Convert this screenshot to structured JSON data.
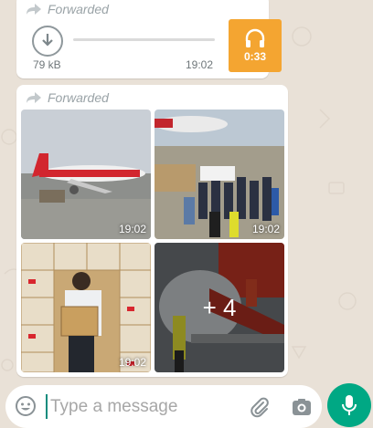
{
  "audio_message": {
    "forwarded_label": "Forwarded",
    "file_size": "79 kB",
    "time": "19:02",
    "duration": "0:33",
    "thumb_color": "#f4a531",
    "icons": [
      "download-icon",
      "headphones-icon",
      "forward-arrow-icon"
    ]
  },
  "album_message": {
    "forwarded_label": "Forwarded",
    "photos": [
      {
        "time": "19:02"
      },
      {
        "time": "19:02"
      },
      {
        "time": "19:02"
      },
      {
        "more_count": "+ 4"
      }
    ]
  },
  "composer": {
    "placeholder": "Type a message",
    "accent": "#00a884",
    "icons": [
      "emoji-icon",
      "attach-icon",
      "camera-icon",
      "mic-icon"
    ]
  }
}
